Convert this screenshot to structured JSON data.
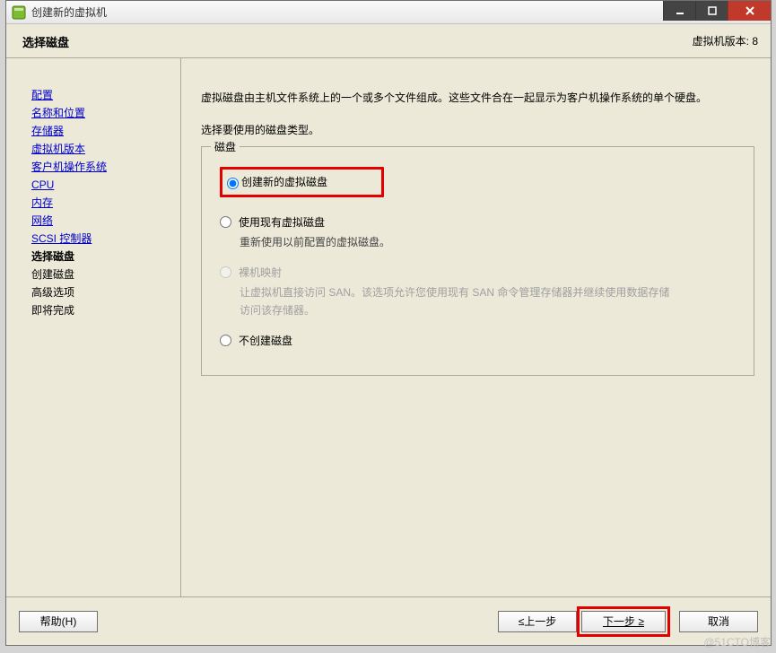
{
  "window": {
    "title": "创建新的虚拟机"
  },
  "header": {
    "title": "选择磁盘",
    "version": "虚拟机版本: 8"
  },
  "sidebar": {
    "items": [
      {
        "label": "配置",
        "link": true
      },
      {
        "label": "名称和位置",
        "link": true
      },
      {
        "label": "存储器",
        "link": true
      },
      {
        "label": "虚拟机版本",
        "link": true
      },
      {
        "label": "客户机操作系统",
        "link": true
      },
      {
        "label": "CPU",
        "link": true
      },
      {
        "label": "内存",
        "link": true
      },
      {
        "label": "网络",
        "link": true
      },
      {
        "label": "SCSI 控制器",
        "link": true
      },
      {
        "label": "选择磁盘",
        "current": true
      },
      {
        "label": "创建磁盘"
      },
      {
        "label": "高级选项"
      },
      {
        "label": "即将完成"
      }
    ]
  },
  "content": {
    "intro1": "虚拟磁盘由主机文件系统上的一个或多个文件组成。这些文件合在一起显示为客户机操作系统的单个硬盘。",
    "intro2": "选择要使用的磁盘类型。",
    "legend": "磁盘",
    "options": {
      "create": {
        "label": "创建新的虚拟磁盘"
      },
      "existing": {
        "label": "使用现有虚拟磁盘",
        "desc": "重新使用以前配置的虚拟磁盘。"
      },
      "rdm": {
        "label": "裸机映射",
        "desc": "让虚拟机直接访问 SAN。该选项允许您使用现有 SAN 命令管理存储器并继续使用数据存储访问该存储器。"
      },
      "none": {
        "label": "不创建磁盘"
      }
    }
  },
  "footer": {
    "help": "帮助(H)",
    "back": "≤上一步",
    "next": "下一步 ≥",
    "cancel": "取消"
  },
  "watermark": "@51CTO博客"
}
